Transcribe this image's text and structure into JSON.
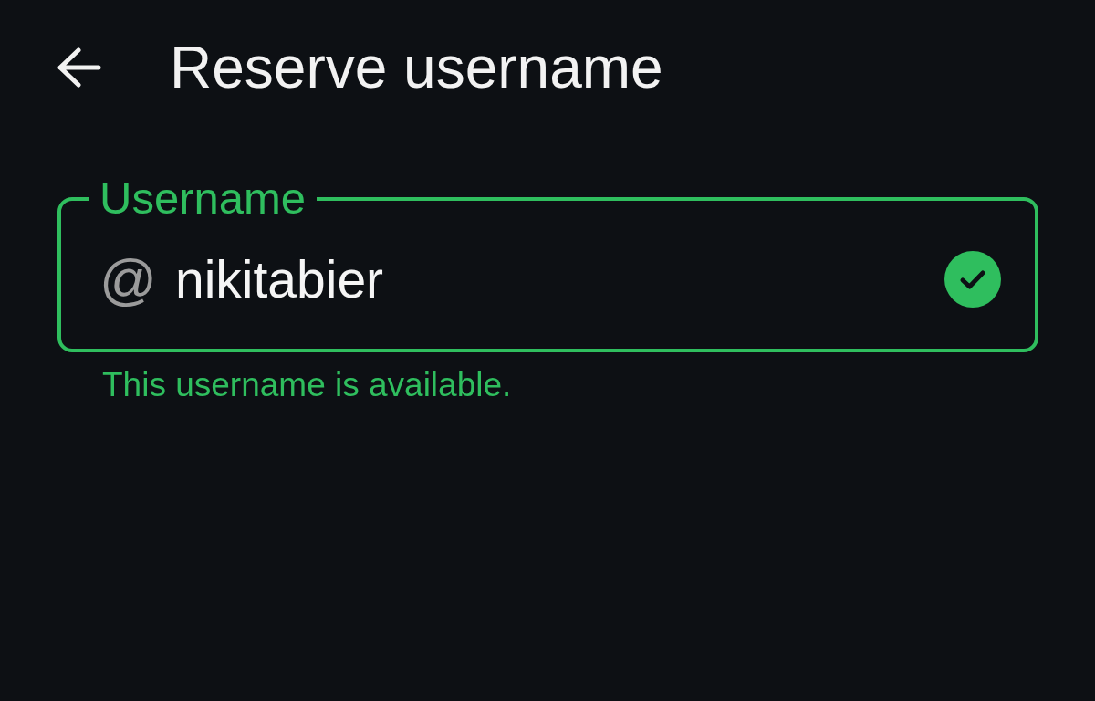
{
  "header": {
    "title": "Reserve username"
  },
  "username_field": {
    "label": "Username",
    "prefix": "@",
    "value": "nikitabier",
    "valid": true
  },
  "helper_text": "This username is available."
}
